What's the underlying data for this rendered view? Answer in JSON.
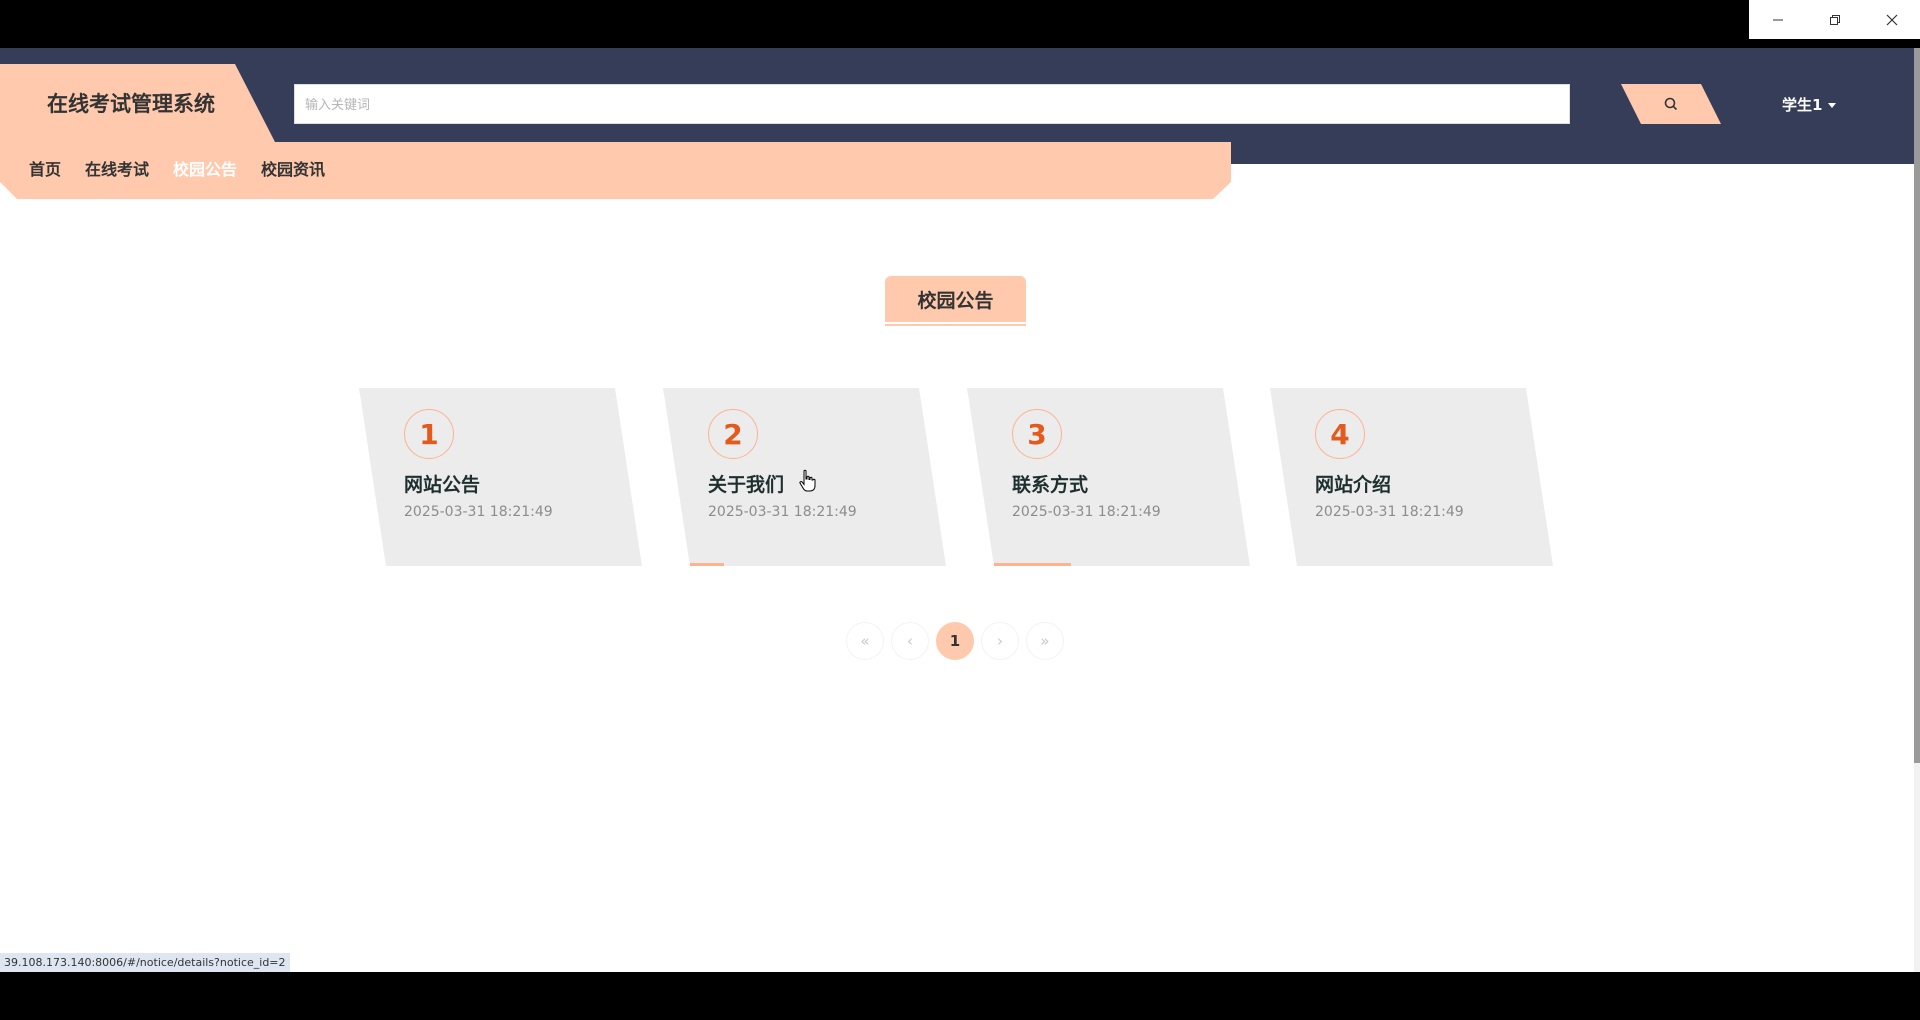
{
  "window_controls": {
    "minimize": "minimize",
    "restore": "restore",
    "close": "close"
  },
  "header": {
    "brand": "在线考试管理系统",
    "search_placeholder": "输入关键词",
    "search_value": "",
    "user_label": "学生1"
  },
  "nav": {
    "items": [
      {
        "label": "首页",
        "active": false
      },
      {
        "label": "在线考试",
        "active": false
      },
      {
        "label": "校园公告",
        "active": true
      },
      {
        "label": "校园资讯",
        "active": false
      }
    ]
  },
  "section": {
    "title": "校园公告"
  },
  "notices": [
    {
      "number": "1",
      "title": "网站公告",
      "date": "2025-03-31 18:21:49"
    },
    {
      "number": "2",
      "title": "关于我们",
      "date": "2025-03-31 18:21:49"
    },
    {
      "number": "3",
      "title": "联系方式",
      "date": "2025-03-31 18:21:49"
    },
    {
      "number": "4",
      "title": "网站介绍",
      "date": "2025-03-31 18:21:49"
    }
  ],
  "pagination": {
    "first": "«",
    "prev": "‹",
    "current": "1",
    "next": "›",
    "last": "»"
  },
  "status_url": "39.108.173.140:8006/#/notice/details?notice_id=2",
  "colors": {
    "header_bg": "#363d59",
    "accent": "#ffc9ad",
    "number_color": "#e35a1c",
    "card_bg": "#ececec"
  }
}
